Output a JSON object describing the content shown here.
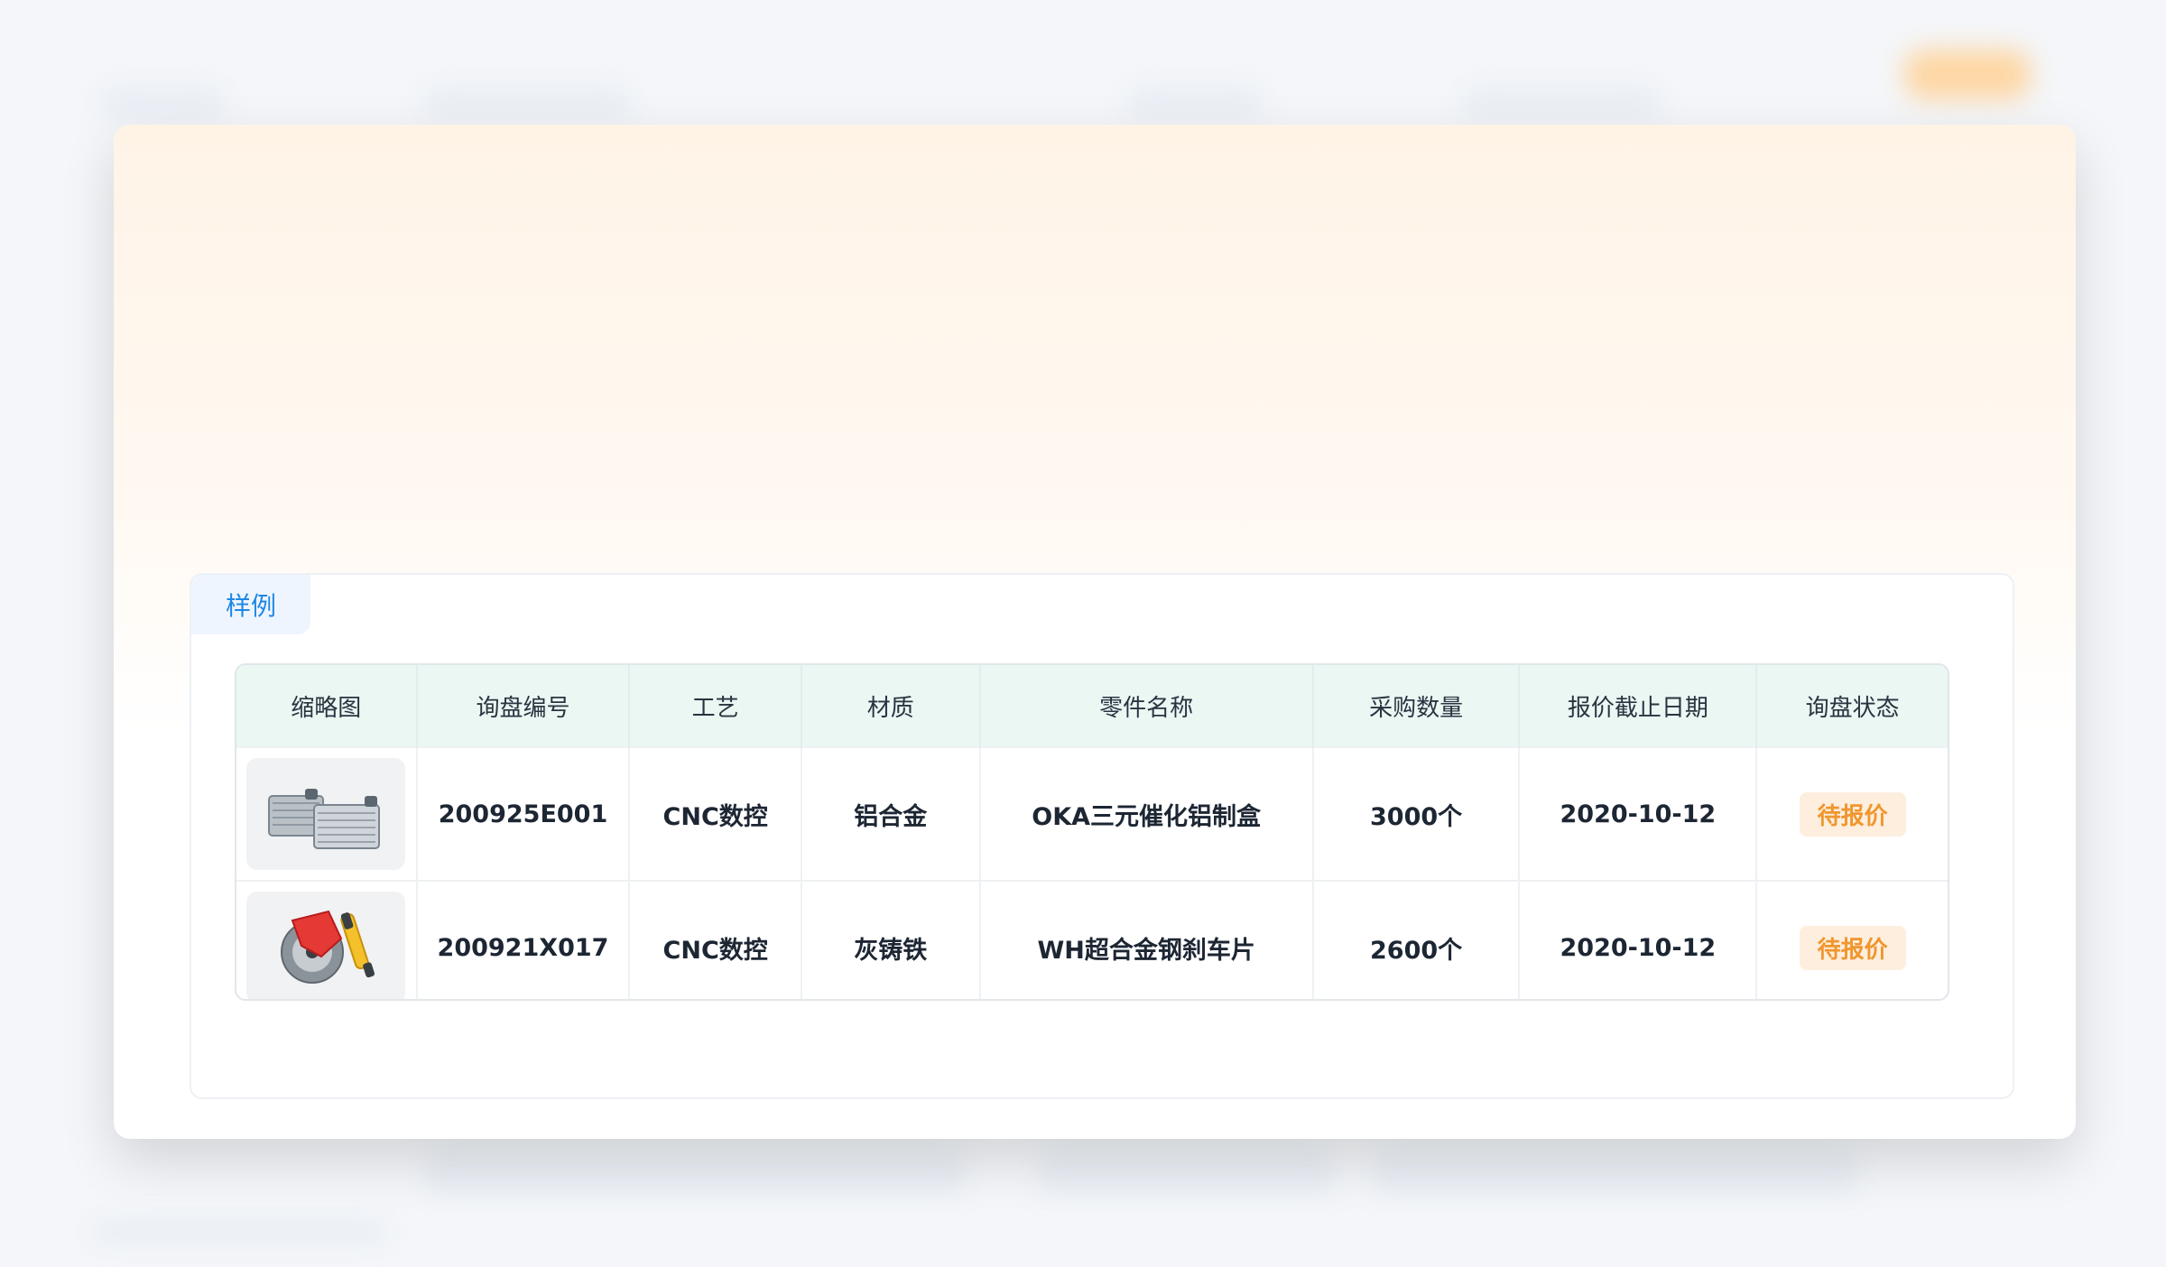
{
  "sample_panel": {
    "tab_label": "样例"
  },
  "table": {
    "headers": [
      "缩略图",
      "询盘编号",
      "工艺",
      "材质",
      "零件名称",
      "采购数量",
      "报价截止日期",
      "询盘状态"
    ],
    "rows": [
      {
        "thumbnail": "radiator-thumbnail",
        "inquiry_no": "200925E001",
        "process": "CNC数控",
        "material": "铝合金",
        "part_name": "OKA三元催化铝制盒",
        "quantity": "3000个",
        "deadline": "2020-10-12",
        "status": "待报价"
      },
      {
        "thumbnail": "brake-caliper-thumbnail",
        "inquiry_no": "200921X017",
        "process": "CNC数控",
        "material": "灰铸铁",
        "part_name": "WH超合金钢刹车片",
        "quantity": "2600个",
        "deadline": "2020-10-12",
        "status": "待报价"
      }
    ]
  },
  "colors": {
    "accent": "#1e88e5",
    "header_bg": "#eaf7f3",
    "status_bg": "#fdeede",
    "status_text": "#f0962d"
  }
}
